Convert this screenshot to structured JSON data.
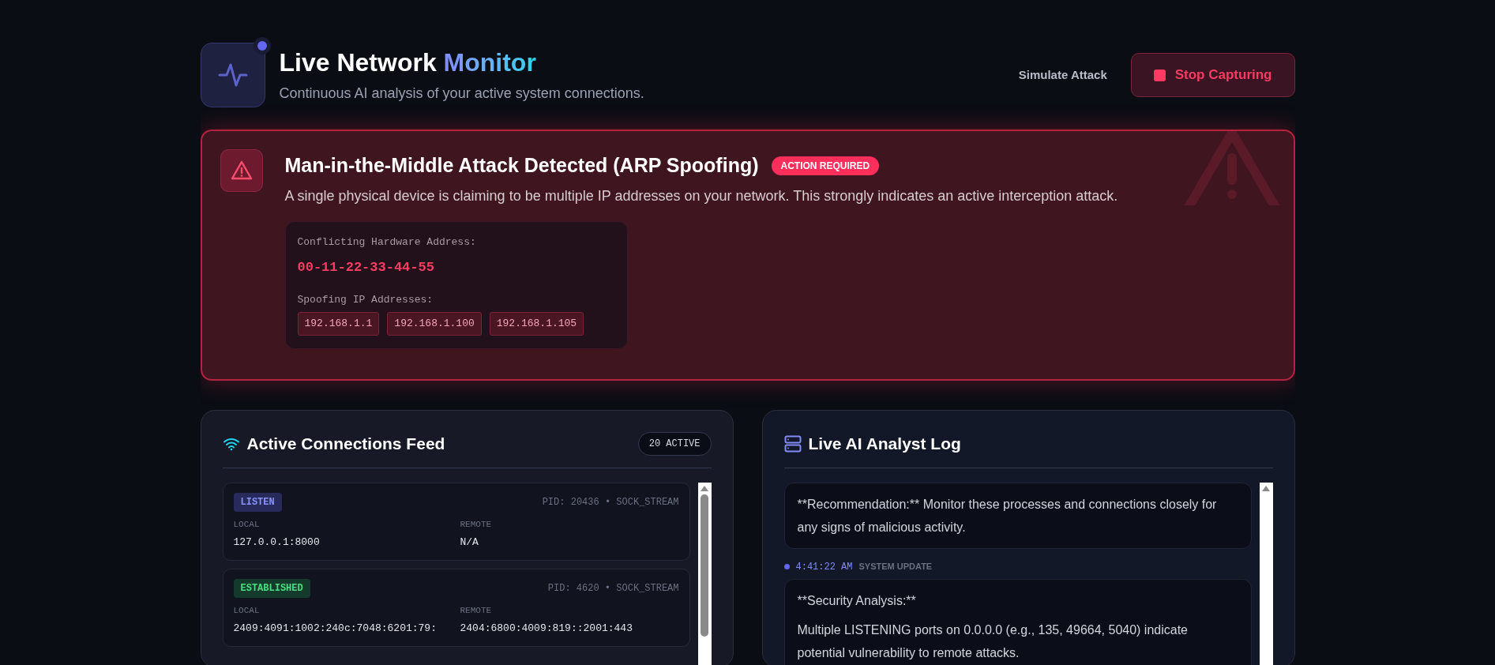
{
  "header": {
    "title": "Live Network",
    "title_accent": "Monitor",
    "subtitle": "Continuous AI analysis of your active system connections.",
    "live": true,
    "simulate_button": "Simulate Attack",
    "stop_button": "Stop Capturing"
  },
  "alert": {
    "title": "Man-in-the-Middle Attack Detected (ARP Spoofing)",
    "badge": "ACTION REQUIRED",
    "description": "A single physical device is claiming to be multiple IP addresses on your network. This strongly indicates an active interception attack.",
    "hardware_label": "Conflicting Hardware Address:",
    "hardware_address": "00-11-22-33-44-55",
    "ip_label": "Spoofing IP Addresses:",
    "ips": [
      "192.168.1.1",
      "192.168.1.100",
      "192.168.1.105"
    ]
  },
  "connections": {
    "title": "Active Connections Feed",
    "count": "20 ACTIVE",
    "items": [
      {
        "status": "LISTEN",
        "kind": "listen",
        "meta": "PID: 20436 • SOCK_STREAM",
        "local_label": "LOCAL",
        "local": "127.0.0.1:8000",
        "remote_label": "REMOTE",
        "remote": "N/A"
      },
      {
        "status": "ESTABLISHED",
        "kind": "established",
        "meta": "PID: 4620 • SOCK_STREAM",
        "local_label": "LOCAL",
        "local": "2409:4091:1002:240c:7048:6201:79:",
        "remote_label": "REMOTE",
        "remote": "2404:6800:4009:819::2001:443"
      }
    ]
  },
  "log": {
    "title": "Live AI Analyst Log",
    "entries": [
      {
        "paragraphs": [
          "**Recommendation:** Monitor these processes and connections closely for any signs of malicious activity."
        ]
      },
      {
        "time": "4:41:22 AM",
        "tag": "SYSTEM UPDATE",
        "paragraphs": [
          "**Security Analysis:**",
          "Multiple LISTENING ports on 0.0.0.0 (e.g., 135, 49664, 5040) indicate potential vulnerability to remote attacks."
        ]
      }
    ]
  }
}
